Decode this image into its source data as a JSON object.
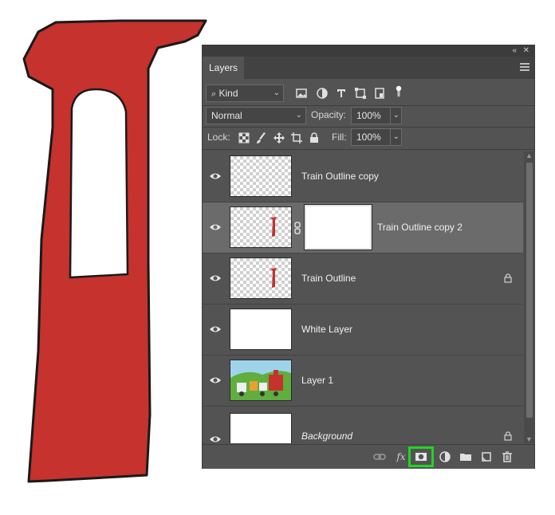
{
  "panel": {
    "tab_label": "Layers",
    "filter": {
      "kind_label": "Kind"
    },
    "blend_mode": "Normal",
    "opacity": {
      "label": "Opacity:",
      "value": "100%"
    },
    "lock": {
      "label": "Lock:"
    },
    "fill": {
      "label": "Fill:",
      "value": "100%"
    }
  },
  "layers": [
    {
      "name": "Train Outline copy",
      "italic": false,
      "selected": false,
      "locked": false,
      "thumb": "checker-faint"
    },
    {
      "name": "Train Outline copy 2",
      "italic": false,
      "selected": true,
      "locked": false,
      "thumb": "checker-red",
      "mask": true
    },
    {
      "name": "Train Outline",
      "italic": false,
      "selected": false,
      "locked": true,
      "thumb": "checker-red"
    },
    {
      "name": "White Layer",
      "italic": false,
      "selected": false,
      "locked": false,
      "thumb": "white"
    },
    {
      "name": "Layer 1",
      "italic": false,
      "selected": false,
      "locked": false,
      "thumb": "illustration"
    },
    {
      "name": "Background",
      "italic": true,
      "selected": false,
      "locked": true,
      "thumb": "white"
    }
  ],
  "bottom_icons": [
    "link-icon",
    "fx-icon",
    "add-mask-icon",
    "adjustment-icon",
    "folder-icon",
    "new-layer-icon",
    "trash-icon"
  ],
  "bottom_labels": {
    "fx": "fx"
  },
  "colors": {
    "panel_bg": "#535353",
    "selected_row": "#6b6b6b",
    "highlight": "#1fd624",
    "art_red": "#c6322d"
  }
}
